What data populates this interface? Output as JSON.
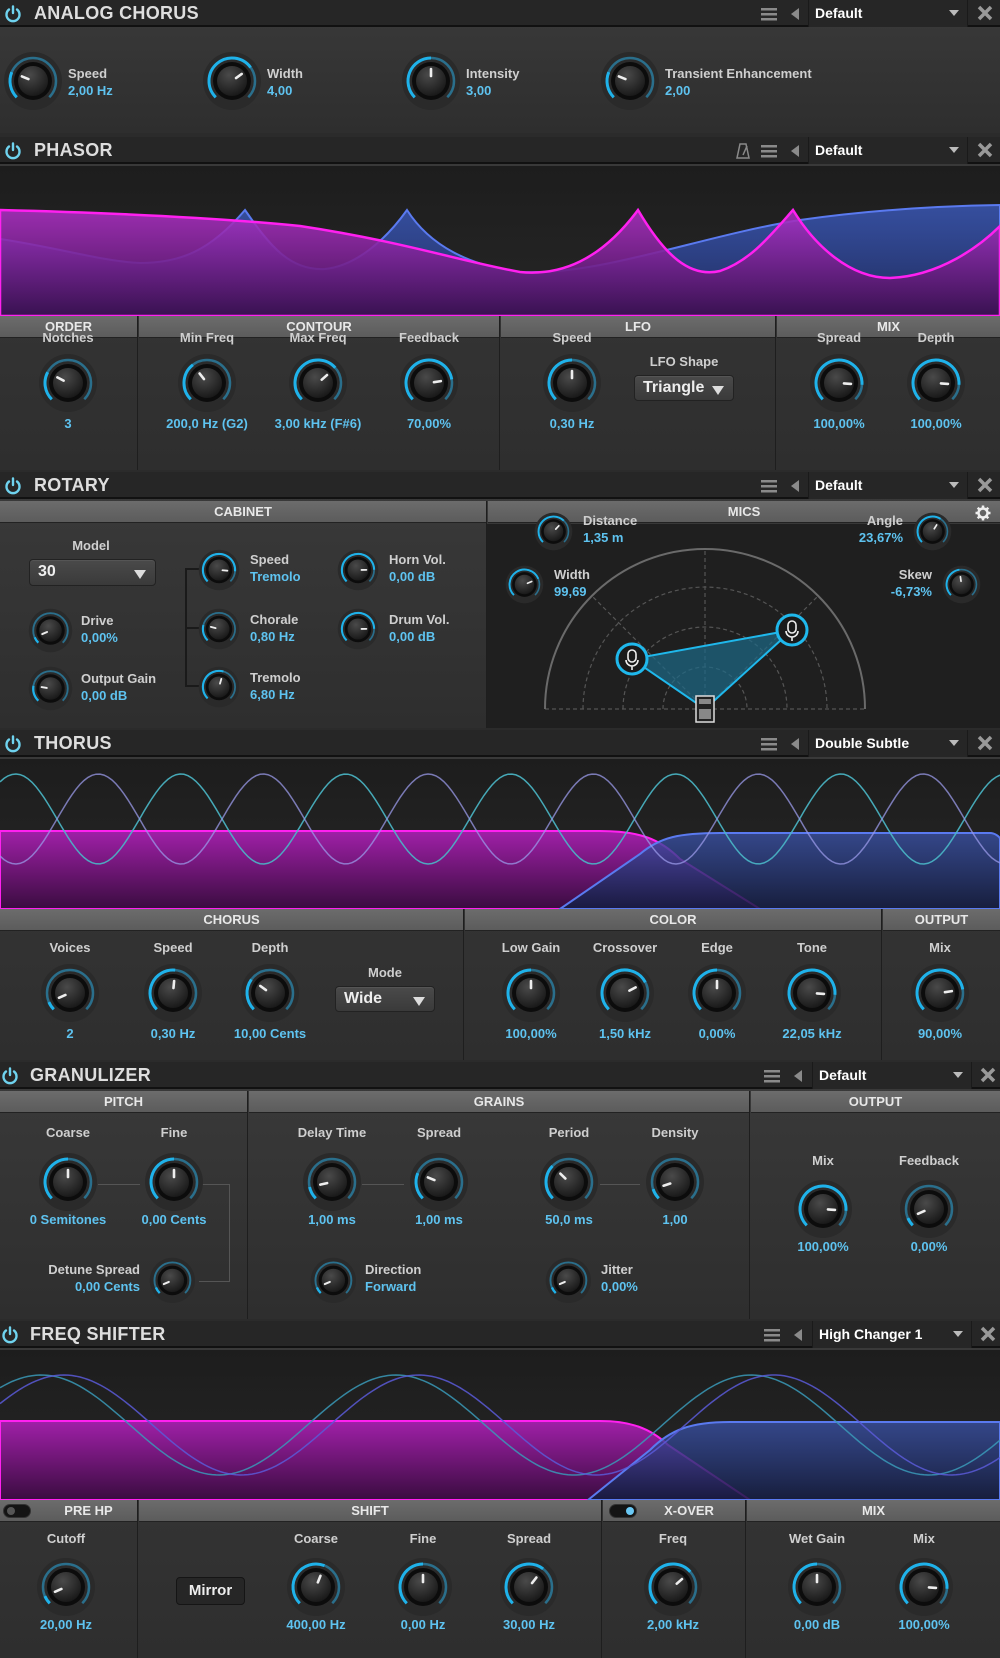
{
  "colors": {
    "accent": "#1fb2ea",
    "value_text": "#5ec3f0",
    "magenta": "#e020e0",
    "blue": "#4a6fe0",
    "teal": "#3fb6c8"
  },
  "header_common": {
    "menu_icon": "hamburger-menu-icon",
    "prev_icon": "triangle-left-icon",
    "next_icon": "triangle-right-icon",
    "close_icon": "close-x-icon",
    "power_icon": "power-icon"
  },
  "analog_chorus": {
    "title": "ANALOG CHORUS",
    "preset": "Default",
    "knobs": [
      {
        "label": "Speed",
        "value": "2,00 Hz",
        "pos": 0.25
      },
      {
        "label": "Width",
        "value": "4,00",
        "pos": 0.7
      },
      {
        "label": "Intensity",
        "value": "3,00",
        "pos": 0.5
      },
      {
        "label": "Transient Enhancement",
        "value": "2,00",
        "pos": 0.25
      }
    ]
  },
  "phasor": {
    "title": "PHASOR",
    "preset": "Default",
    "tempo_icon": "metronome-icon",
    "sections": {
      "order": "ORDER",
      "contour": "CONTOUR",
      "lfo": "LFO",
      "mix": "MIX"
    },
    "knobs": {
      "notches": {
        "label": "Notches",
        "value": "3",
        "pos": 0.27
      },
      "min_freq": {
        "label": "Min Freq",
        "value": "200,0 Hz (G2)",
        "pos": 0.36
      },
      "max_freq": {
        "label": "Max Freq",
        "value": "3,00 kHz (F#6)",
        "pos": 0.68
      },
      "feedback": {
        "label": "Feedback",
        "value": "70,00%",
        "pos": 0.8
      },
      "lfo_speed": {
        "label": "Speed",
        "value": "0,30 Hz",
        "pos": 0.5
      },
      "spread": {
        "label": "Spread",
        "value": "100,00%",
        "pos": 0.85
      },
      "depth": {
        "label": "Depth",
        "value": "100,00%",
        "pos": 0.85
      }
    },
    "lfo_shape": {
      "label": "LFO Shape",
      "value": "Triangle"
    }
  },
  "rotary": {
    "title": "ROTARY",
    "preset": "Default",
    "sections": {
      "cabinet": "CABINET",
      "mics": "MICS"
    },
    "settings_icon": "gear-icon",
    "model": {
      "label": "Model",
      "value": "30"
    },
    "knobs": {
      "drive": {
        "label": "Drive",
        "value": "0,00%",
        "pos": 0.08
      },
      "output_gain": {
        "label": "Output Gain",
        "value": "0,00 dB",
        "pos": 0.2
      },
      "speed": {
        "label": "Speed",
        "value": "Tremolo",
        "pos": 0.85
      },
      "chorale": {
        "label": "Chorale",
        "value": "0,80 Hz",
        "pos": 0.22
      },
      "tremolo": {
        "label": "Tremolo",
        "value": "6,80 Hz",
        "pos": 0.56
      },
      "horn_vol": {
        "label": "Horn Vol.",
        "value": "0,00 dB",
        "pos": 0.83
      },
      "drum_vol": {
        "label": "Drum Vol.",
        "value": "0,00 dB",
        "pos": 0.83
      },
      "distance": {
        "label": "Distance",
        "value": "1,35 m",
        "pos": 0.66
      },
      "width": {
        "label": "Width",
        "value": "99,69",
        "pos": 0.75
      },
      "angle": {
        "label": "Angle",
        "value": "23,67%",
        "pos": 0.62
      },
      "skew": {
        "label": "Skew",
        "value": "-6,73%",
        "pos": 0.47
      }
    },
    "mic_icon": "microphone-icon",
    "speaker_icon": "rotary-cabinet-icon"
  },
  "thorus": {
    "title": "THORUS",
    "preset": "Double Subtle",
    "sections": {
      "chorus": "CHORUS",
      "color": "COLOR",
      "output": "OUTPUT"
    },
    "knobs": {
      "voices": {
        "label": "Voices",
        "value": "2",
        "pos": 0.08
      },
      "speed": {
        "label": "Speed",
        "value": "0,30 Hz",
        "pos": 0.52
      },
      "depth": {
        "label": "Depth",
        "value": "10,00 Cents",
        "pos": 0.3
      },
      "low_gain": {
        "label": "Low Gain",
        "value": "100,00%",
        "pos": 0.5
      },
      "crossover": {
        "label": "Crossover",
        "value": "1,50 kHz",
        "pos": 0.73
      },
      "edge": {
        "label": "Edge",
        "value": "0,00%",
        "pos": 0.5
      },
      "tone": {
        "label": "Tone",
        "value": "22,05 kHz",
        "pos": 0.85
      },
      "mix": {
        "label": "Mix",
        "value": "90,00%",
        "pos": 0.8
      }
    },
    "mode": {
      "label": "Mode",
      "value": "Wide"
    }
  },
  "granulizer": {
    "title": "GRANULIZER",
    "preset": "Default",
    "sections": {
      "pitch": "PITCH",
      "grains": "GRAINS",
      "output": "OUTPUT"
    },
    "knobs": {
      "coarse": {
        "label": "Coarse",
        "value": "0 Semitones",
        "pos": 0.5
      },
      "fine": {
        "label": "Fine",
        "value": "0,00 Cents",
        "pos": 0.5
      },
      "detune_spread": {
        "label": "Detune Spread",
        "value": "0,00 Cents",
        "pos": 0.08
      },
      "delay_time": {
        "label": "Delay Time",
        "value": "1,00 ms",
        "pos": 0.12
      },
      "spread": {
        "label": "Spread",
        "value": "1,00 ms",
        "pos": 0.25
      },
      "direction": {
        "label": "Direction",
        "value": "Forward",
        "pos": 0.08
      },
      "period": {
        "label": "Period",
        "value": "50,0 ms",
        "pos": 0.33
      },
      "density": {
        "label": "Density",
        "value": "1,00",
        "pos": 0.1
      },
      "jitter": {
        "label": "Jitter",
        "value": "0,00%",
        "pos": 0.08
      },
      "mix": {
        "label": "Mix",
        "value": "100,00%",
        "pos": 0.85
      },
      "feedback": {
        "label": "Feedback",
        "value": "0,00%",
        "pos": 0.08
      }
    }
  },
  "freq_shifter": {
    "title": "FREQ SHIFTER",
    "preset": "High Changer 1",
    "sections": {
      "pre_hp": "PRE HP",
      "shift": "SHIFT",
      "x_over": "X-OVER",
      "mix": "MIX"
    },
    "pre_hp_enabled": false,
    "x_over_enabled": true,
    "mirror_label": "Mirror",
    "knobs": {
      "cutoff": {
        "label": "Cutoff",
        "value": "20,00 Hz",
        "pos": 0.08
      },
      "coarse": {
        "label": "Coarse",
        "value": "400,00 Hz",
        "pos": 0.58
      },
      "fine": {
        "label": "Fine",
        "value": "0,00 Hz",
        "pos": 0.5
      },
      "spread": {
        "label": "Spread",
        "value": "30,00 Hz",
        "pos": 0.64
      },
      "freq": {
        "label": "Freq",
        "value": "2,00 kHz",
        "pos": 0.68
      },
      "wet_gain": {
        "label": "Wet Gain",
        "value": "0,00 dB",
        "pos": 0.5
      },
      "mix": {
        "label": "Mix",
        "value": "100,00%",
        "pos": 0.85
      }
    }
  }
}
